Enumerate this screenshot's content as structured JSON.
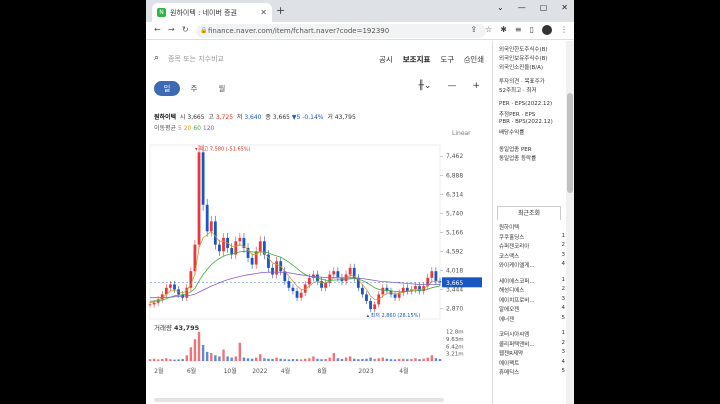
{
  "browser": {
    "tab_title": "원하이텍 : 네이버 증권",
    "favicon_letter": "N",
    "url": "finance.naver.com/item/fchart.naver?code=192390"
  },
  "search": {
    "placeholder": "종목 또는 지수비교"
  },
  "menu": [
    "공시",
    "보조지표",
    "도구",
    "인쇄"
  ],
  "periods": [
    "일",
    "주",
    "월"
  ],
  "quote": {
    "name": "원하이텍",
    "open_label": "시",
    "open": "3,665",
    "high_label": "고",
    "high": "3,725",
    "low_label": "저",
    "low": "3,640",
    "close_label": "종",
    "close": "3,665",
    "change": "▼5",
    "change_pct": "-0.14%",
    "volume_label": "거",
    "volume": "43,795"
  },
  "moving_average": {
    "label": "이동평균",
    "m5": "5",
    "m20": "20",
    "m60": "60",
    "m120": "120"
  },
  "scale_mode": "Linear",
  "volume_caption": {
    "label": "거래량",
    "value": "43,795"
  },
  "colors": {
    "up": "#e8383d",
    "down": "#1a56c2",
    "active": "#3d6ab3",
    "ma5": "#e07070",
    "ma20": "#d49a2a",
    "ma60": "#3da83d",
    "ma120": "#8b5fc9"
  },
  "chart_data": {
    "type": "line",
    "price_ticks": [
      "7,462",
      "6,888",
      "6,314",
      "5,740",
      "5,166",
      "4,592",
      "4,018",
      "3,444",
      "2,870"
    ],
    "price_tick_values": [
      7462,
      6888,
      6314,
      5740,
      5166,
      4592,
      4018,
      3444,
      2870
    ],
    "ylim": [
      2560,
      7800
    ],
    "current_price": "3,665",
    "current_price_value": 3665,
    "max_annotation": "최고 7,580 (-51.65%)",
    "max_value": 7580,
    "min_annotation": "최저 2,860 (28.15%)",
    "min_value": 2860,
    "x_ticks": [
      "2월",
      "6월",
      "10월",
      "2022",
      "4월",
      "8월",
      "2023",
      "4월"
    ],
    "volume_ticks": [
      "12.8m",
      "9.63m",
      "6.42m",
      "3.21m"
    ],
    "volume_tick_values": [
      12.8,
      9.63,
      6.42,
      3.21
    ],
    "volume_max": 14,
    "series": [
      {
        "values": [
          3000,
          3050,
          3150,
          3300,
          3500,
          3600,
          3450,
          3300,
          3200,
          3500,
          4000,
          4800,
          7580,
          6000,
          5200,
          5500,
          4800,
          4600,
          5000,
          4700,
          4500,
          4900,
          5000,
          4700,
          4400,
          4200,
          4600,
          4900,
          4500,
          4100,
          3900,
          4300,
          4000,
          3700,
          3500,
          3400,
          3200,
          3350,
          3600,
          3800,
          3900,
          3700,
          3500,
          3650,
          3900,
          4000,
          3800,
          3700,
          3900,
          4100,
          3800,
          3500,
          3300,
          3100,
          2860,
          3000,
          3300,
          3500,
          3400,
          3300,
          3200,
          3350,
          3500,
          3400,
          3450,
          3550,
          3400,
          3550,
          3800,
          4000,
          3700,
          3665
        ]
      },
      {
        "values": [
          3050,
          3080,
          3120,
          3200,
          3300,
          3400,
          3420,
          3380,
          3340,
          3420,
          3600,
          3900,
          4700,
          5000,
          5100,
          5200,
          5050,
          4900,
          4900,
          4850,
          4750,
          4750,
          4800,
          4750,
          4650,
          4500,
          4500,
          4600,
          4550,
          4400,
          4250,
          4200,
          4150,
          4000,
          3850,
          3700,
          3550,
          3450,
          3450,
          3550,
          3650,
          3700,
          3650,
          3650,
          3700,
          3800,
          3820,
          3780,
          3800,
          3880,
          3850,
          3750,
          3600,
          3450,
          3250,
          3150,
          3150,
          3250,
          3330,
          3350,
          3320,
          3320,
          3380,
          3400,
          3420,
          3460,
          3450,
          3480,
          3560,
          3680,
          3700,
          3700
        ]
      },
      {
        "values": [
          3100,
          3100,
          3110,
          3130,
          3170,
          3220,
          3260,
          3280,
          3290,
          3320,
          3380,
          3480,
          3700,
          3900,
          4050,
          4200,
          4300,
          4380,
          4450,
          4500,
          4520,
          4550,
          4580,
          4600,
          4600,
          4580,
          4570,
          4580,
          4580,
          4550,
          4500,
          4460,
          4420,
          4350,
          4270,
          4180,
          4080,
          3980,
          3900,
          3850,
          3820,
          3790,
          3760,
          3730,
          3720,
          3730,
          3740,
          3740,
          3750,
          3770,
          3780,
          3760,
          3720,
          3660,
          3580,
          3500,
          3450,
          3430,
          3420,
          3410,
          3390,
          3380,
          3380,
          3390,
          3400,
          3410,
          3420,
          3430,
          3460,
          3500,
          3530,
          3560
        ]
      },
      {
        "values": [
          3200,
          3200,
          3200,
          3200,
          3210,
          3220,
          3230,
          3240,
          3250,
          3260,
          3280,
          3310,
          3370,
          3430,
          3490,
          3550,
          3600,
          3650,
          3700,
          3740,
          3780,
          3810,
          3840,
          3870,
          3890,
          3910,
          3930,
          3950,
          3960,
          3970,
          3970,
          3970,
          3970,
          3960,
          3950,
          3930,
          3910,
          3890,
          3870,
          3850,
          3840,
          3830,
          3820,
          3810,
          3800,
          3800,
          3800,
          3800,
          3800,
          3800,
          3800,
          3790,
          3780,
          3760,
          3740,
          3720,
          3700,
          3690,
          3680,
          3670,
          3660,
          3650,
          3640,
          3630,
          3620,
          3610,
          3600,
          3600,
          3600,
          3600,
          3600,
          3600
        ]
      }
    ],
    "volume": [
      0.8,
      1.0,
      0.7,
      0.9,
      1.2,
      0.8,
      0.6,
      0.7,
      0.9,
      2.5,
      6.0,
      9.5,
      12.8,
      7.0,
      4.0,
      3.5,
      2.5,
      2.0,
      5.0,
      2.0,
      1.5,
      2.0,
      8.0,
      1.5,
      1.2,
      1.0,
      1.5,
      3.0,
      1.2,
      1.0,
      0.9,
      1.5,
      1.0,
      0.8,
      0.7,
      0.9,
      0.8,
      0.7,
      1.0,
      1.2,
      2.0,
      1.0,
      0.8,
      0.9,
      1.5,
      3.5,
      1.2,
      0.9,
      1.5,
      2.0,
      1.0,
      0.8,
      0.9,
      1.0,
      1.5,
      0.9,
      1.2,
      1.5,
      1.0,
      0.8,
      0.7,
      0.9,
      1.0,
      0.8,
      0.9,
      1.2,
      0.8,
      1.0,
      1.5,
      2.5,
      1.2,
      0.9
    ]
  },
  "side_top": [
    "외국인한도주식수(B)",
    "외국인보유주식수(B)",
    "외국인소진율(B/A)",
    "투자의견 · 목표주가",
    "52주최고 · 최저",
    "PER · EPS(2022.12)",
    "추정PER · EPS",
    "PBR · BPS(2022.12)",
    "배당수익률",
    "동일업종 PER",
    "동일업종 등락률"
  ],
  "side_recent_title": "최근조회",
  "recent_list": [
    {
      "name": "원하이텍",
      "n": ""
    },
    {
      "name": "쿠쿠홀딩스",
      "n": "1"
    },
    {
      "name": "슈퍼젠코리아",
      "n": "2"
    },
    {
      "name": "코스맥스",
      "n": "3"
    },
    {
      "name": "와이케이엘게...",
      "n": "4"
    },
    {
      "gap": true
    },
    {
      "name": "세이에스코퍼...",
      "n": "1"
    },
    {
      "name": "해성디에스",
      "n": "2"
    },
    {
      "name": "에이치프로비...",
      "n": "3"
    },
    {
      "name": "알에오젠",
      "n": "4"
    },
    {
      "name": "에너젠",
      "n": "5"
    },
    {
      "gap": true
    },
    {
      "name": "코터시아씨엠",
      "n": "1"
    },
    {
      "name": "콜리퍼텍앤비...",
      "n": "2"
    },
    {
      "name": "웹젠R제약",
      "n": "3"
    },
    {
      "name": "에이팩트",
      "n": "4"
    },
    {
      "name": "휴메딕스",
      "n": "5"
    }
  ]
}
